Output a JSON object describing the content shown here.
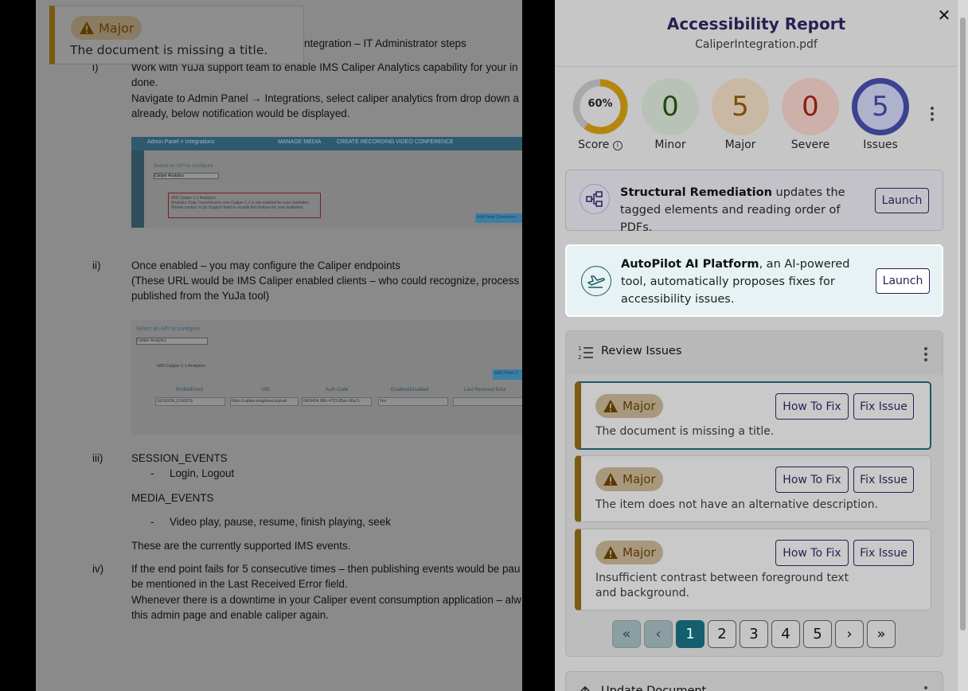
{
  "document": {
    "heading_fragment": "ntegration – IT Administrator steps",
    "items": [
      {
        "num": "i)",
        "lines": [
          "Work with YuJa support team to enable IMS Caliper Analytics capability for your in",
          "done.",
          "Navigate to Admin Panel → Integrations, select caliper analytics from drop down a",
          "already, below notification would be displayed."
        ]
      },
      {
        "num": "ii)",
        "lines": [
          "Once enabled – you may configure the Caliper endpoints",
          "(These URL would be IMS Caliper enabled clients – who could recognize, process a",
          "published from the YuJa tool)"
        ]
      },
      {
        "num": "iii)",
        "lines": [
          "SESSION_EVENTS"
        ]
      },
      {
        "num": "iv)",
        "lines": [
          "If the end point fails for 5 consecutive times – then publishing events would be pau",
          "be mentioned in the Last Received Error field.",
          "Whenever there is a downtime in your Caliper event consumption application – alw",
          "this admin page and enable caliper again."
        ]
      }
    ],
    "session_sub": "Login, Logout",
    "media_heading": "MEDIA_EVENTS",
    "media_sub": "Video play, pause, resume, finish playing, seek",
    "supported_note": "These are the currently supported IMS events.",
    "screenshot1": {
      "breadcrumb": "Admin Panel > Integrations",
      "tab1": "MANAGE MEDIA",
      "tab2": "CREATE RECORDING",
      "tab3": "VIDEO CONFERENCE",
      "select_label": "Select an API to configure",
      "select_value": "Caliper Analytics",
      "warn_title": "IMS Caliper 1.1 Analytics",
      "warn_line1": "Analytics Data Transmission over Caliper 1.1 is not enabled for your institution.",
      "warn_line2": "Please contact YuJa Support team to enable this feature for your institution.",
      "add_button": "Add New Consumer"
    },
    "screenshot2": {
      "select_label": "Select an API to configure",
      "select_value": "Caliper Analytics",
      "section": "IMS Caliper 1.1 Analytics",
      "add_button": "Add New C",
      "headers": [
        "Profile/Event",
        "URL",
        "Auth Code",
        "Enabled/Disabled",
        "Last Received Error"
      ],
      "row": [
        "SESSION_EVENTS",
        "https://caliper.imsglobal.org/cali",
        "0406454 9f6c-4725-85ec-06a7c",
        "Yes",
        ""
      ]
    }
  },
  "tooltip": {
    "badge": "Major",
    "text": "The document is missing a title."
  },
  "panel": {
    "title": "Accessibility Report",
    "filename": "CaliperIntegration.pdf",
    "close_glyph": "✕",
    "stats": {
      "score_pct": "60%",
      "score_value": 0.6,
      "score_label": "Score",
      "minor_value": "0",
      "minor_label": "Minor",
      "major_value": "5",
      "major_label": "Major",
      "severe_value": "0",
      "severe_label": "Severe",
      "issues_value": "5",
      "issues_label": "Issues"
    },
    "structural": {
      "bold": "Structural Remediation",
      "rest": " updates the tagged elements and reading order of PDFs.",
      "button": "Launch"
    },
    "autopilot": {
      "bold": "AutoPilot AI Platform",
      "rest": ", an AI-powered tool, automatically proposes fixes for accessibility issues.",
      "button": "Launch"
    },
    "review": {
      "title": "Review Issues",
      "issues": [
        {
          "severity": "Major",
          "desc": "The document is missing a title.",
          "how": "How To Fix",
          "fix": "Fix Issue"
        },
        {
          "severity": "Major",
          "desc": "The item does not have an alternative description.",
          "how": "How To Fix",
          "fix": "Fix Issue"
        },
        {
          "severity": "Major",
          "desc": "Insufficient contrast between foreground text and background.",
          "how": "How To Fix",
          "fix": "Fix Issue"
        }
      ],
      "pagination": {
        "first": "«",
        "prev": "‹",
        "pages": [
          "1",
          "2",
          "3",
          "4",
          "5"
        ],
        "current": "1",
        "next": "›",
        "last": "»"
      }
    },
    "update_title": "Update Document"
  },
  "colors": {
    "accent": "#2a1f52",
    "major": "#7c5b12",
    "teal": "#155e6e",
    "score_ring": "#b5860f"
  }
}
